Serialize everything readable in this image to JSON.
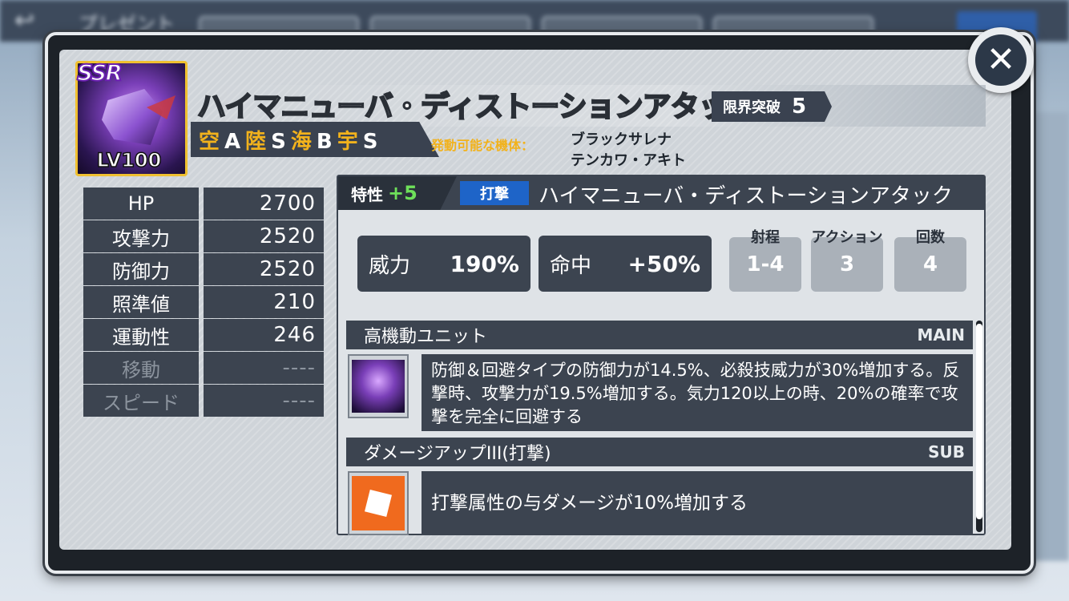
{
  "background": {
    "screen_title": "プレゼント"
  },
  "unit": {
    "rarity": "SSR",
    "level": "LV100",
    "title": "ハイマニューバ・ディストーションアタック",
    "limit_break_label": "限界突破",
    "limit_break_value": "5",
    "terrain": [
      {
        "type": "空",
        "rank": "A"
      },
      {
        "type": "陸",
        "rank": "S"
      },
      {
        "type": "海",
        "rank": "B"
      },
      {
        "type": "宇",
        "rank": "S"
      }
    ],
    "pilot_label": "発動可能な機体：",
    "pilots": [
      "ブラックサレナ",
      "テンカワ・アキト"
    ]
  },
  "stats": [
    {
      "label": "HP",
      "value": "2700"
    },
    {
      "label": "攻撃力",
      "value": "2520"
    },
    {
      "label": "防御力",
      "value": "2520"
    },
    {
      "label": "照準値",
      "value": "210"
    },
    {
      "label": "運動性",
      "value": "246"
    },
    {
      "label": "移動",
      "value": "----"
    },
    {
      "label": "スピード",
      "value": "----"
    }
  ],
  "weapon": {
    "trait_label": "特性",
    "trait_value": "+5",
    "attack_type": "打撃",
    "name": "ハイマニューバ・ディストーションアタック",
    "power_label": "威力",
    "power_value": "190%",
    "accuracy_label": "命中",
    "accuracy_value": "+50%",
    "range_label": "射程",
    "range_value": "1-4",
    "action_label": "アクション",
    "action_value": "3",
    "count_label": "回数",
    "count_value": "4"
  },
  "skills": [
    {
      "name": "高機動ユニット",
      "tag": "MAIN",
      "description": "防御＆回避タイプの防御力が14.5%、必殺技威力が30%増加する。反撃時、攻撃力が19.5%増加する。気力120以上の時、20%の確率で攻撃を完全に回避する"
    },
    {
      "name": "ダメージアップIII(打撃)",
      "tag": "SUB",
      "description": "打撃属性の与ダメージが10%増加する"
    }
  ],
  "colors": {
    "accent_gold": "#f2b21c",
    "trait_green": "#6ee05a",
    "type_blue": "#1e64c8",
    "panel_dark": "#3c4450"
  },
  "icons": {
    "close": "close-icon"
  }
}
